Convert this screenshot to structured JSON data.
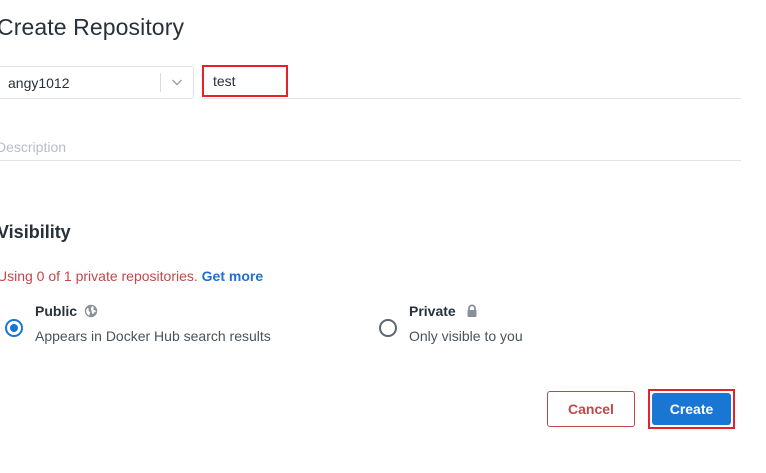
{
  "header": {
    "title": "Create Repository"
  },
  "form": {
    "namespace": "angy1012",
    "namespace_icon": "chevron-down-icon",
    "name_value": "test",
    "description_placeholder": "Description",
    "description_value": ""
  },
  "visibility": {
    "title": "Visibility",
    "quota_text": "Using 0 of 1 private repositories.",
    "get_more_label": "Get more",
    "selected": "public",
    "options": [
      {
        "key": "public",
        "title": "Public",
        "description": "Appears in Docker Hub search results",
        "icon": "globe-icon"
      },
      {
        "key": "private",
        "title": "Private",
        "description": "Only visible to you",
        "icon": "lock-icon"
      }
    ]
  },
  "actions": {
    "cancel_label": "Cancel",
    "create_label": "Create"
  },
  "colors": {
    "primary": "#1976d2",
    "danger": "#c14848",
    "highlight": "#e8202a",
    "link": "#1f6fd6"
  }
}
